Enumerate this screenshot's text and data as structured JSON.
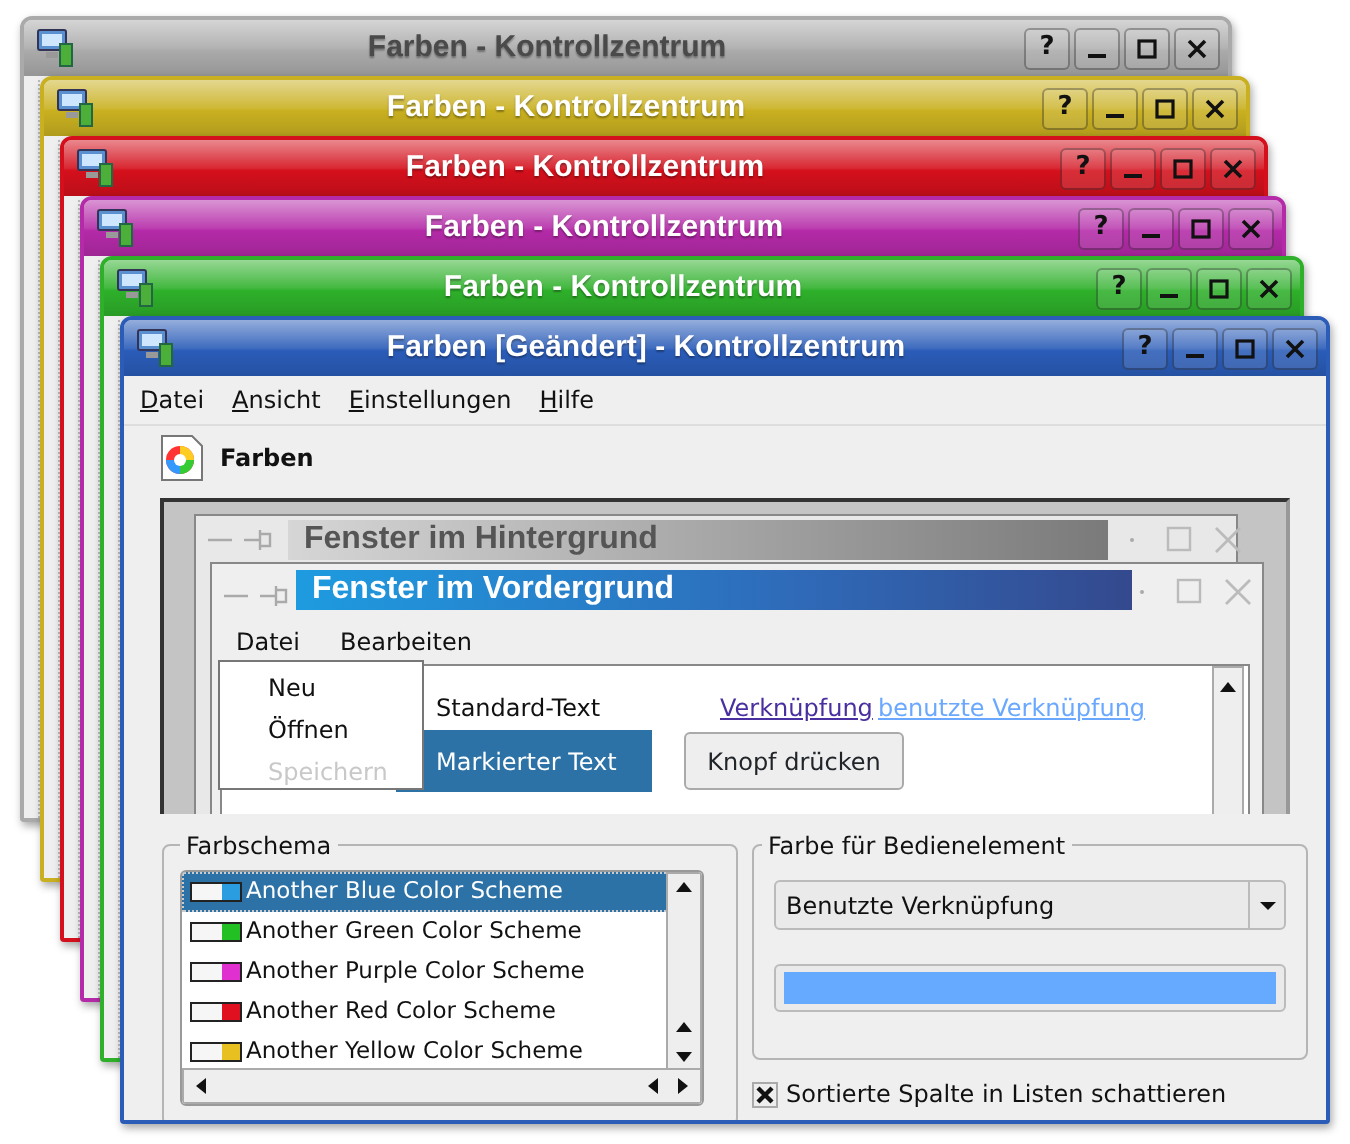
{
  "background_windows": [
    {
      "title": "Farben - Kontrollzentrum",
      "color": "#aaaaaa",
      "dimmed": true,
      "help": "?"
    },
    {
      "title": "Farben - Kontrollzentrum",
      "color": "#c9b020",
      "dimmed": false,
      "help": "?"
    },
    {
      "title": "Farben - Kontrollzentrum",
      "color": "#d4101c",
      "dimmed": false,
      "help": "?"
    },
    {
      "title": "Farben - Kontrollzentrum",
      "color": "#b42aa8",
      "dimmed": false,
      "help": "?"
    },
    {
      "title": "Farben - Kontrollzentrum",
      "color": "#2eb02a",
      "dimmed": false,
      "help": "?"
    }
  ],
  "window": {
    "title": "Farben [Geändert] - Kontrollzentrum",
    "color": "#2a5cb8",
    "help": "?"
  },
  "menu": [
    "Datei",
    "Ansicht",
    "Einstellungen",
    "Hilfe"
  ],
  "module": {
    "title": "Farben"
  },
  "preview": {
    "inactive_title": "Fenster im Hintergrund",
    "active_title": "Fenster im Vordergrund",
    "menu": [
      "Datei",
      "Bearbeiten"
    ],
    "popup": [
      {
        "label": "Neu",
        "disabled": false
      },
      {
        "label": "Öffnen",
        "disabled": false
      },
      {
        "label": "Speichern",
        "disabled": true
      }
    ],
    "standard_text": "Standard-Text",
    "selected_text": "Markierter Text",
    "link": "Verknüpfung",
    "visited_link": "benutzte Verknüpfung",
    "button": "Knopf drücken"
  },
  "scheme_group": {
    "title": "Farbschema",
    "items": [
      {
        "label": "Another Blue Color Scheme",
        "color": "#2a9ce0",
        "selected": true
      },
      {
        "label": "Another Green Color Scheme",
        "color": "#22c022",
        "selected": false
      },
      {
        "label": "Another Purple Color Scheme",
        "color": "#e030d0",
        "selected": false
      },
      {
        "label": "Another Red Color Scheme",
        "color": "#e01020",
        "selected": false
      },
      {
        "label": "Another Yellow Color Scheme",
        "color": "#e8c020",
        "selected": false
      }
    ]
  },
  "widget_group": {
    "title": "Farbe für Bedienelement",
    "value": "Benutzte Verknüpfung",
    "color": "#66aaff"
  },
  "checkbox": {
    "label": "Sortierte Spalte in Listen schattieren",
    "checked": true
  }
}
